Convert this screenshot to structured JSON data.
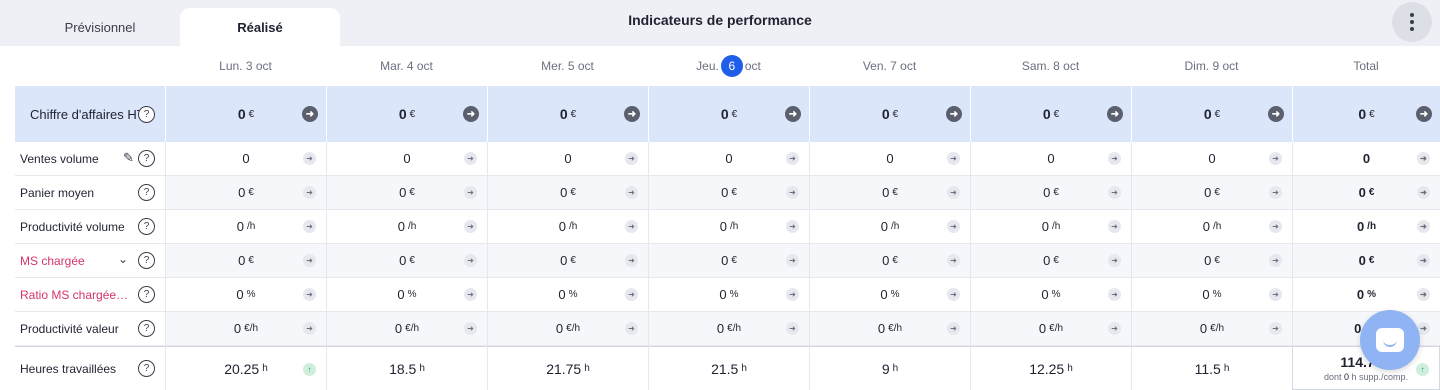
{
  "tabs": {
    "forecast": "Prévisionnel",
    "actual": "Réalisé"
  },
  "page_title": "Indicateurs de performance",
  "days": [
    {
      "prefix": "Lun. 3 oct",
      "badge": "",
      "suffix": ""
    },
    {
      "prefix": "Mar. 4 oct",
      "badge": "",
      "suffix": ""
    },
    {
      "prefix": "Mer. 5 oct",
      "badge": "",
      "suffix": ""
    },
    {
      "prefix": "Jeu.",
      "badge": "6",
      "suffix": "oct"
    },
    {
      "prefix": "Ven. 7 oct",
      "badge": "",
      "suffix": ""
    },
    {
      "prefix": "Sam. 8 oct",
      "badge": "",
      "suffix": ""
    },
    {
      "prefix": "Dim. 9 oct",
      "badge": "",
      "suffix": ""
    }
  ],
  "total_label": "Total",
  "ca_row": {
    "label": "Chiffre d'affaires HT",
    "value": "0",
    "unit": "€"
  },
  "rows": [
    {
      "label": "Ventes volume",
      "color": "#1f2230",
      "icon": "pencil-icon",
      "value": "0",
      "unit": ""
    },
    {
      "label": "Panier moyen",
      "color": "#1f2230",
      "icon": "",
      "value": "0",
      "unit": "€"
    },
    {
      "label": "Productivité volume",
      "color": "#1f2230",
      "icon": "",
      "value": "0",
      "unit": "/h"
    },
    {
      "label": "MS chargée",
      "color": "#d6336c",
      "icon": "chevron-down-icon",
      "value": "0",
      "unit": "€"
    },
    {
      "label": "Ratio MS chargée / ...",
      "color": "#d6336c",
      "icon": "",
      "value": "0",
      "unit": "%"
    },
    {
      "label": "Productivité valeur",
      "color": "#1f2230",
      "icon": "",
      "value": "0",
      "unit": "€/h"
    }
  ],
  "hours": {
    "label": "Heures travaillées",
    "values": [
      "20.25",
      "18.5",
      "21.75",
      "21.5",
      "9",
      "12.25",
      "11.5"
    ],
    "total": "114.75",
    "unit": "h",
    "sub_prefix": "dont",
    "sub_value": "0",
    "sub_suffix": "h supp./comp."
  },
  "colors": {
    "accent": "#1f5eea",
    "ca_background": "#dbe6fb",
    "alert": "#d6336c"
  }
}
